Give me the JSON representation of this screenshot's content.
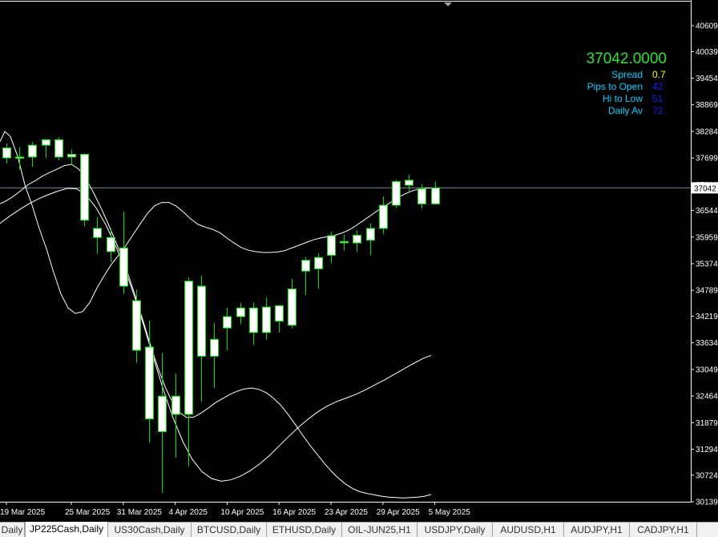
{
  "colors": {
    "background": "#000000",
    "bull_body": "#ffffff",
    "bear_body": "#ffffff",
    "candle_outline": "#00e000",
    "wick": "#00e000",
    "envelope": "#ffffff",
    "axis": "#ffffff",
    "bid_line": "#6e8a96",
    "price_text": "#33e033",
    "label_text": "#00cfff",
    "spread_value": "#ffff00",
    "info_value": "#1a1aff"
  },
  "info": {
    "price": "37042.0000",
    "rows": [
      {
        "label": "Spread",
        "value": "0.7",
        "color": "#ffff00"
      },
      {
        "label": "Pips to Open",
        "value": "42",
        "color": "#1a1aff"
      },
      {
        "label": "Hi to Low",
        "value": "51",
        "color": "#1a1aff"
      },
      {
        "label": "Daily Av",
        "value": "72",
        "color": "#1a1aff"
      }
    ]
  },
  "chart_data": {
    "type": "candlestick",
    "y_ticks": [
      40609,
      40039,
      39454,
      38869,
      38284,
      37699,
      37114,
      36544,
      35959,
      35374,
      34789,
      34219,
      33634,
      33049,
      32464,
      31879,
      31294,
      30724,
      30139
    ],
    "current_price_label": "37042",
    "current_price": 37042,
    "ylim": [
      30139,
      40609
    ],
    "x_date_labels": [
      "19 Mar 2025",
      "25 Mar 2025",
      "31 Mar 2025",
      "4 Apr 2025",
      "10 Apr 2025",
      "16 Apr 2025",
      "23 Apr 2025",
      "29 Apr 2025",
      "5 May 2025"
    ],
    "x_date_label_slots": [
      0,
      5,
      9,
      13,
      17,
      21,
      25,
      29,
      33
    ],
    "candles": [
      {
        "o": 37920,
        "h": 38020,
        "l": 37580,
        "c": 37700
      },
      {
        "o": 37700,
        "h": 37940,
        "l": 37440,
        "c": 37720
      },
      {
        "o": 37720,
        "h": 38050,
        "l": 37500,
        "c": 37980
      },
      {
        "o": 37980,
        "h": 38120,
        "l": 37700,
        "c": 38100
      },
      {
        "o": 38100,
        "h": 38150,
        "l": 37650,
        "c": 37720
      },
      {
        "o": 37720,
        "h": 37880,
        "l": 37550,
        "c": 37780
      },
      {
        "o": 37780,
        "h": 37800,
        "l": 36200,
        "c": 36330
      },
      {
        "o": 36150,
        "h": 36400,
        "l": 35590,
        "c": 35950
      },
      {
        "o": 35950,
        "h": 36150,
        "l": 35410,
        "c": 35640
      },
      {
        "o": 35720,
        "h": 36520,
        "l": 34710,
        "c": 34880
      },
      {
        "o": 34560,
        "h": 34800,
        "l": 33190,
        "c": 33470
      },
      {
        "o": 33540,
        "h": 34130,
        "l": 31440,
        "c": 31960
      },
      {
        "o": 31680,
        "h": 33410,
        "l": 30330,
        "c": 32460
      },
      {
        "o": 32460,
        "h": 32950,
        "l": 31110,
        "c": 32060
      },
      {
        "o": 32060,
        "h": 35070,
        "l": 30920,
        "c": 34990
      },
      {
        "o": 34880,
        "h": 35110,
        "l": 32340,
        "c": 33340
      },
      {
        "o": 33340,
        "h": 34070,
        "l": 32640,
        "c": 33710
      },
      {
        "o": 33960,
        "h": 34410,
        "l": 33470,
        "c": 34210
      },
      {
        "o": 34210,
        "h": 34510,
        "l": 34040,
        "c": 34400
      },
      {
        "o": 34400,
        "h": 34520,
        "l": 33590,
        "c": 33860
      },
      {
        "o": 33860,
        "h": 34630,
        "l": 33710,
        "c": 34420
      },
      {
        "o": 34110,
        "h": 34430,
        "l": 33860,
        "c": 34450
      },
      {
        "o": 34020,
        "h": 35040,
        "l": 33950,
        "c": 34820
      },
      {
        "o": 35210,
        "h": 35520,
        "l": 34690,
        "c": 35450
      },
      {
        "o": 35260,
        "h": 35600,
        "l": 34820,
        "c": 35510
      },
      {
        "o": 35560,
        "h": 36080,
        "l": 35380,
        "c": 35990
      },
      {
        "o": 35850,
        "h": 36020,
        "l": 35660,
        "c": 35860
      },
      {
        "o": 35830,
        "h": 36110,
        "l": 35630,
        "c": 36000
      },
      {
        "o": 35890,
        "h": 36260,
        "l": 35560,
        "c": 36150
      },
      {
        "o": 36150,
        "h": 36850,
        "l": 36020,
        "c": 36660
      },
      {
        "o": 36660,
        "h": 37220,
        "l": 36600,
        "c": 37180
      },
      {
        "o": 37210,
        "h": 37330,
        "l": 36970,
        "c": 37100
      },
      {
        "o": 37020,
        "h": 37130,
        "l": 36590,
        "c": 36690
      },
      {
        "o": 36690,
        "h": 37180,
        "l": 36670,
        "c": 37042
      }
    ],
    "envelope_upper": [
      [
        0,
        38060
      ],
      [
        6,
        38280
      ],
      [
        13,
        38170
      ],
      [
        22,
        37740
      ],
      [
        31,
        37110
      ],
      [
        40,
        36660
      ],
      [
        49,
        36150
      ],
      [
        58,
        35700
      ],
      [
        67,
        35180
      ],
      [
        76,
        34710
      ],
      [
        85,
        34400
      ],
      [
        94,
        34280
      ],
      [
        103,
        34320
      ],
      [
        112,
        34520
      ],
      [
        121,
        34840
      ],
      [
        130,
        35110
      ],
      [
        139,
        35360
      ],
      [
        148,
        35560
      ],
      [
        157,
        35770
      ],
      [
        166,
        36010
      ],
      [
        175,
        36250
      ],
      [
        184,
        36480
      ],
      [
        193,
        36650
      ],
      [
        202,
        36720
      ],
      [
        211,
        36720
      ],
      [
        220,
        36640
      ],
      [
        229,
        36510
      ],
      [
        238,
        36360
      ],
      [
        247,
        36240
      ],
      [
        256,
        36180
      ],
      [
        265,
        36130
      ],
      [
        274,
        36060
      ],
      [
        283,
        35940
      ],
      [
        292,
        35830
      ],
      [
        301,
        35730
      ],
      [
        310,
        35670
      ],
      [
        319,
        35640
      ],
      [
        328,
        35620
      ],
      [
        337,
        35620
      ],
      [
        346,
        35630
      ],
      [
        355,
        35660
      ],
      [
        364,
        35720
      ],
      [
        373,
        35780
      ],
      [
        382,
        35840
      ],
      [
        391,
        35900
      ],
      [
        400,
        35940
      ],
      [
        409,
        35970
      ],
      [
        418,
        36000
      ],
      [
        427,
        36050
      ],
      [
        436,
        36120
      ],
      [
        445,
        36220
      ],
      [
        454,
        36330
      ],
      [
        463,
        36440
      ],
      [
        472,
        36550
      ],
      [
        481,
        36650
      ],
      [
        490,
        36750
      ],
      [
        499,
        36850
      ],
      [
        508,
        36930
      ],
      [
        517,
        36990
      ],
      [
        526,
        37020
      ],
      [
        535,
        37040
      ],
      [
        538,
        37040
      ]
    ],
    "envelope_middle": [
      [
        0,
        36690
      ],
      [
        8,
        36760
      ],
      [
        17,
        36860
      ],
      [
        26,
        36980
      ],
      [
        35,
        37110
      ],
      [
        44,
        37200
      ],
      [
        53,
        37300
      ],
      [
        62,
        37380
      ],
      [
        71,
        37450
      ],
      [
        80,
        37530
      ],
      [
        89,
        37560
      ],
      [
        98,
        37460
      ],
      [
        107,
        37250
      ],
      [
        116,
        36960
      ],
      [
        125,
        36640
      ],
      [
        134,
        36290
      ],
      [
        143,
        35920
      ],
      [
        152,
        35520
      ],
      [
        161,
        35080
      ],
      [
        170,
        34600
      ],
      [
        179,
        34090
      ],
      [
        188,
        33570
      ],
      [
        197,
        33090
      ],
      [
        206,
        32670
      ],
      [
        215,
        32330
      ],
      [
        224,
        32100
      ],
      [
        233,
        31990
      ],
      [
        242,
        32000
      ],
      [
        251,
        32090
      ],
      [
        260,
        32200
      ],
      [
        269,
        32320
      ],
      [
        278,
        32410
      ],
      [
        287,
        32500
      ],
      [
        296,
        32570
      ],
      [
        305,
        32620
      ],
      [
        314,
        32640
      ],
      [
        323,
        32610
      ],
      [
        332,
        32540
      ],
      [
        341,
        32420
      ],
      [
        350,
        32270
      ],
      [
        359,
        32070
      ],
      [
        368,
        31850
      ],
      [
        377,
        31620
      ],
      [
        386,
        31400
      ],
      [
        395,
        31200
      ],
      [
        404,
        31000
      ],
      [
        413,
        30820
      ],
      [
        422,
        30660
      ],
      [
        431,
        30530
      ],
      [
        440,
        30430
      ],
      [
        449,
        30360
      ],
      [
        458,
        30320
      ],
      [
        467,
        30290
      ],
      [
        476,
        30260
      ],
      [
        485,
        30240
      ],
      [
        494,
        30230
      ],
      [
        503,
        30220
      ],
      [
        512,
        30230
      ],
      [
        521,
        30240
      ],
      [
        530,
        30260
      ],
      [
        538,
        30300
      ]
    ],
    "envelope_lower": [
      [
        0,
        36260
      ],
      [
        12,
        36420
      ],
      [
        24,
        36560
      ],
      [
        36,
        36690
      ],
      [
        48,
        36800
      ],
      [
        60,
        36890
      ],
      [
        72,
        36970
      ],
      [
        84,
        37030
      ],
      [
        96,
        37020
      ],
      [
        108,
        36870
      ],
      [
        120,
        36600
      ],
      [
        132,
        36230
      ],
      [
        144,
        35780
      ],
      [
        156,
        35250
      ],
      [
        168,
        34650
      ],
      [
        180,
        33980
      ],
      [
        192,
        33280
      ],
      [
        204,
        32590
      ],
      [
        216,
        31980
      ],
      [
        228,
        31470
      ],
      [
        240,
        31070
      ],
      [
        252,
        30800
      ],
      [
        264,
        30650
      ],
      [
        276,
        30590
      ],
      [
        288,
        30620
      ],
      [
        300,
        30700
      ],
      [
        312,
        30820
      ],
      [
        324,
        30970
      ],
      [
        336,
        31150
      ],
      [
        348,
        31360
      ],
      [
        360,
        31570
      ],
      [
        372,
        31770
      ],
      [
        384,
        31950
      ],
      [
        396,
        32110
      ],
      [
        408,
        32240
      ],
      [
        420,
        32340
      ],
      [
        432,
        32420
      ],
      [
        444,
        32500
      ],
      [
        456,
        32600
      ],
      [
        468,
        32710
      ],
      [
        480,
        32820
      ],
      [
        492,
        32940
      ],
      [
        504,
        33060
      ],
      [
        516,
        33180
      ],
      [
        528,
        33290
      ],
      [
        538,
        33360
      ]
    ]
  },
  "tabs": [
    {
      "label": "Daily",
      "width": 31,
      "active": false
    },
    {
      "label": "JP225Cash,Daily",
      "width": 104,
      "active": true
    },
    {
      "label": "US30Cash,Daily",
      "width": 104,
      "active": false
    },
    {
      "label": "BTCUSD,Daily",
      "width": 94,
      "active": false
    },
    {
      "label": "ETHUSD,Daily",
      "width": 94,
      "active": false
    },
    {
      "label": "OIL-JUN25,H1",
      "width": 94,
      "active": false
    },
    {
      "label": "USDJPY,Daily",
      "width": 94,
      "active": false
    },
    {
      "label": "AUDUSD,H1",
      "width": 89,
      "active": false
    },
    {
      "label": "AUDJPY,H1",
      "width": 82,
      "active": false
    },
    {
      "label": "CADJPY,H1",
      "width": 84,
      "active": false
    }
  ]
}
